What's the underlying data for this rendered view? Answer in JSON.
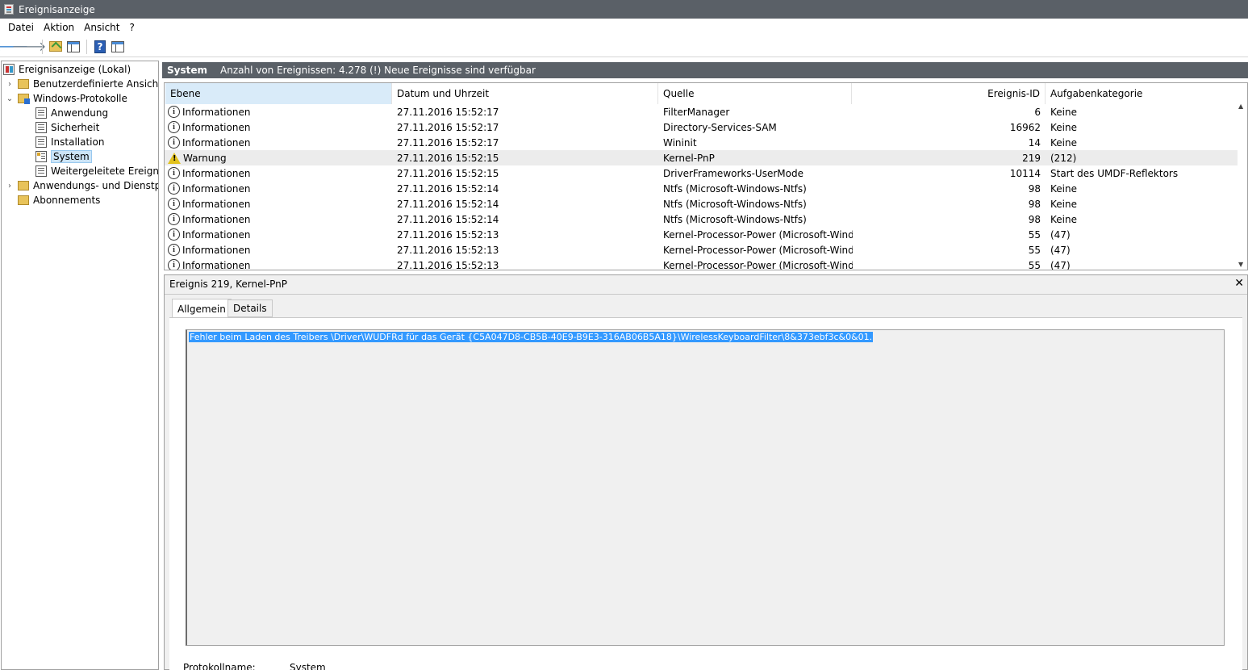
{
  "window": {
    "title": "Ereignisanzeige"
  },
  "menu": [
    "Datei",
    "Aktion",
    "Ansicht",
    "?"
  ],
  "toolbar": {
    "icons": [
      "back-arrow-icon",
      "forward-arrow-icon",
      "up-folder-icon",
      "show-hide-tree-icon",
      "help-icon",
      "action-pane-icon"
    ]
  },
  "tree": {
    "root": "Ereignisanzeige (Lokal)",
    "custom_views": "Benutzerdefinierte Ansichten",
    "windows_logs": "Windows-Protokolle",
    "logs": [
      "Anwendung",
      "Sicherheit",
      "Installation",
      "System",
      "Weitergeleitete Ereignisse"
    ],
    "app_services": "Anwendungs- und Dienstprotokolle",
    "subscriptions": "Abonnements",
    "selected": "System"
  },
  "header": {
    "title": "System",
    "summary": "Anzahl von Ereignissen: 4.278 (!) Neue Ereignisse sind verfügbar"
  },
  "columns": {
    "level": "Ebene",
    "datetime": "Datum und Uhrzeit",
    "source": "Quelle",
    "event_id": "Ereignis-ID",
    "task": "Aufgabenkategorie"
  },
  "events": [
    {
      "level": "Informationen",
      "type": "info",
      "datetime": "27.11.2016 15:52:17",
      "source": "FilterManager",
      "id": "6",
      "task": "Keine"
    },
    {
      "level": "Informationen",
      "type": "info",
      "datetime": "27.11.2016 15:52:17",
      "source": "Directory-Services-SAM",
      "id": "16962",
      "task": "Keine"
    },
    {
      "level": "Informationen",
      "type": "info",
      "datetime": "27.11.2016 15:52:17",
      "source": "Wininit",
      "id": "14",
      "task": "Keine"
    },
    {
      "level": "Warnung",
      "type": "warning",
      "datetime": "27.11.2016 15:52:15",
      "source": "Kernel-PnP",
      "id": "219",
      "task": "(212)"
    },
    {
      "level": "Informationen",
      "type": "info",
      "datetime": "27.11.2016 15:52:15",
      "source": "DriverFrameworks-UserMode",
      "id": "10114",
      "task": "Start des UMDF-Reflektors"
    },
    {
      "level": "Informationen",
      "type": "info",
      "datetime": "27.11.2016 15:52:14",
      "source": "Ntfs (Microsoft-Windows-Ntfs)",
      "id": "98",
      "task": "Keine"
    },
    {
      "level": "Informationen",
      "type": "info",
      "datetime": "27.11.2016 15:52:14",
      "source": "Ntfs (Microsoft-Windows-Ntfs)",
      "id": "98",
      "task": "Keine"
    },
    {
      "level": "Informationen",
      "type": "info",
      "datetime": "27.11.2016 15:52:14",
      "source": "Ntfs (Microsoft-Windows-Ntfs)",
      "id": "98",
      "task": "Keine"
    },
    {
      "level": "Informationen",
      "type": "info",
      "datetime": "27.11.2016 15:52:13",
      "source": "Kernel-Processor-Power (Microsoft-Wind...",
      "id": "55",
      "task": "(47)"
    },
    {
      "level": "Informationen",
      "type": "info",
      "datetime": "27.11.2016 15:52:13",
      "source": "Kernel-Processor-Power (Microsoft-Wind...",
      "id": "55",
      "task": "(47)"
    },
    {
      "level": "Informationen",
      "type": "info",
      "datetime": "27.11.2016 15:52:13",
      "source": "Kernel-Processor-Power (Microsoft-Wind...",
      "id": "55",
      "task": "(47)"
    }
  ],
  "selected_event_index": 3,
  "detail": {
    "title": "Ereignis 219, Kernel-PnP",
    "close": "✕",
    "tabs": [
      "Allgemein",
      "Details"
    ],
    "message": "Fehler beim Laden des Treibers \\Driver\\WUDFRd für das Gerät {C5A047D8-CB5B-40E9-B9E3-316AB06B5A18}\\WirelessKeyboardFilter\\8&373ebf3c&0&01.",
    "properties": [
      {
        "label": "Protokollname:",
        "value": "System"
      }
    ]
  }
}
